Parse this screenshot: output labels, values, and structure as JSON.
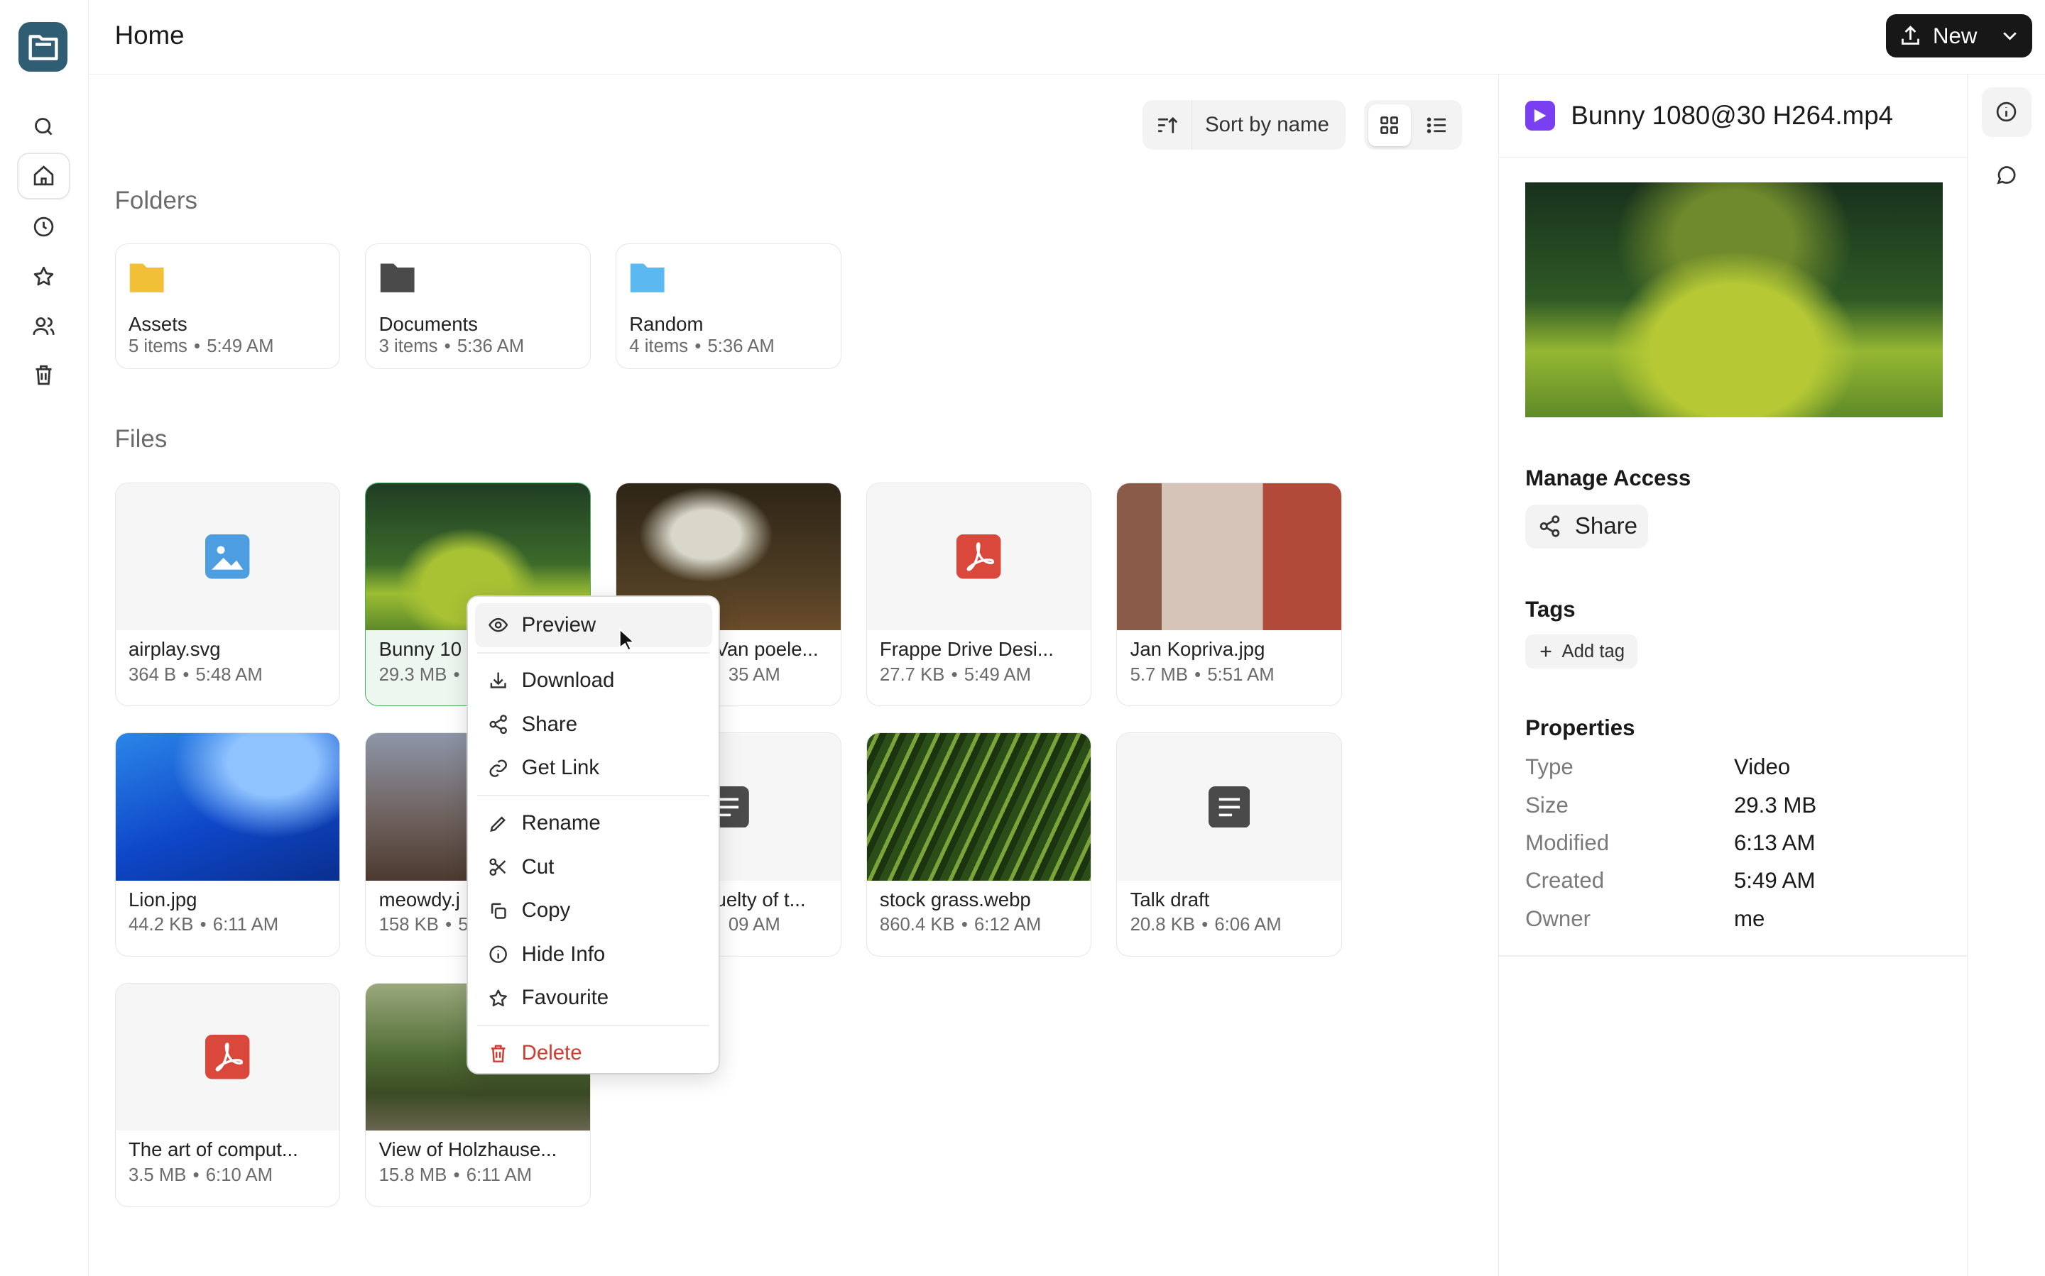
{
  "header": {
    "title": "Home",
    "new_label": "New"
  },
  "toolbar": {
    "sort_label": "Sort by name"
  },
  "sections": {
    "folders": "Folders",
    "files": "Files"
  },
  "folders": [
    {
      "name": "Assets",
      "items": "5 items",
      "time": "5:49 AM",
      "color": "#f2c037"
    },
    {
      "name": "Documents",
      "items": "3 items",
      "time": "5:36 AM",
      "color": "#4a4a4a"
    },
    {
      "name": "Random",
      "items": "4 items",
      "time": "5:36 AM",
      "color": "#5bb8f0"
    }
  ],
  "files": [
    {
      "name": "airplay.svg",
      "size": "364 B",
      "time": "5:48 AM",
      "kind": "image-icon"
    },
    {
      "name": "Bunny 1080@30 H264.mp4",
      "size": "29.3 MB",
      "time": "5:49 AM",
      "kind": "video"
    },
    {
      "name": "Van poelenburgh.jpg",
      "size": "",
      "time": "5:35 AM",
      "kind": "photo"
    },
    {
      "name": "Frappe Drive Design.pdf",
      "size": "27.7 KB",
      "time": "5:49 AM",
      "kind": "pdf-icon"
    },
    {
      "name": "Jan Kopriva.jpg",
      "size": "5.7 MB",
      "time": "5:51 AM",
      "kind": "photo"
    },
    {
      "name": "Lion.jpg",
      "size": "44.2 KB",
      "time": "6:11 AM",
      "kind": "photo"
    },
    {
      "name": "meowdy.jpg",
      "size": "158 KB",
      "time": "",
      "kind": "photo"
    },
    {
      "name": "Cruelty of the...",
      "size": "",
      "time": "6:09 AM",
      "kind": "doc-icon"
    },
    {
      "name": "stock grass.webp",
      "size": "860.4 KB",
      "time": "6:12 AM",
      "kind": "photo"
    },
    {
      "name": "Talk draft",
      "size": "20.8 KB",
      "time": "6:06 AM",
      "kind": "doc-icon"
    },
    {
      "name": "The art of computer programming.pdf",
      "size": "3.5 MB",
      "time": "6:10 AM",
      "kind": "pdf-icon"
    },
    {
      "name": "View of Holzhausen.jpg",
      "size": "15.8 MB",
      "time": "6:11 AM",
      "kind": "photo"
    }
  ],
  "file_labels": {
    "airplay": "airplay.svg",
    "bunny": "Bunny 10",
    "vanpoel": "Van poele...",
    "frappe": "Frappe Drive Desi...",
    "jan": "Jan Kopriva.jpg",
    "lion": "Lion.jpg",
    "meowdy": "meowdy.j",
    "cruelty": "uelty of t...",
    "grass": "stock grass.webp",
    "talk": "Talk draft",
    "art": "The art of comput...",
    "holz": "View of Holzhause..."
  },
  "file_meta": {
    "airplay": [
      "364 B",
      "5:48 AM"
    ],
    "bunny": [
      "29.3 MB",
      ""
    ],
    "vanpoel": [
      "",
      "35 AM"
    ],
    "frappe": [
      "27.7 KB",
      "5:49 AM"
    ],
    "jan": [
      "5.7 MB",
      "5:51 AM"
    ],
    "lion": [
      "44.2 KB",
      "6:11 AM"
    ],
    "meowdy": [
      "158 KB",
      "5"
    ],
    "cruelty": [
      "",
      "09 AM"
    ],
    "grass": [
      "860.4 KB",
      "6:12 AM"
    ],
    "talk": [
      "20.8 KB",
      "6:06 AM"
    ],
    "art": [
      "3.5 MB",
      "6:10 AM"
    ],
    "holz": [
      "15.8 MB",
      "6:11 AM"
    ]
  },
  "context_menu": {
    "preview": "Preview",
    "download": "Download",
    "share": "Share",
    "get_link": "Get Link",
    "rename": "Rename",
    "cut": "Cut",
    "copy": "Copy",
    "hide_info": "Hide Info",
    "favourite": "Favourite",
    "delete": "Delete"
  },
  "info_panel": {
    "title": "Bunny 1080@30 H264.mp4",
    "manage_access": "Manage Access",
    "share_label": "Share",
    "tags": "Tags",
    "add_tag": "Add tag",
    "properties_title": "Properties",
    "properties": [
      {
        "key": "Type",
        "value": "Video"
      },
      {
        "key": "Size",
        "value": "29.3 MB"
      },
      {
        "key": "Modified",
        "value": "6:13 AM"
      },
      {
        "key": "Created",
        "value": "5:49 AM"
      },
      {
        "key": "Owner",
        "value": "me"
      }
    ]
  },
  "colors": {
    "accent": "#2f5d73",
    "danger": "#d03c2f",
    "video": "#7a3ff0",
    "pdf": "#d9483b",
    "image": "#4d9ee0"
  }
}
